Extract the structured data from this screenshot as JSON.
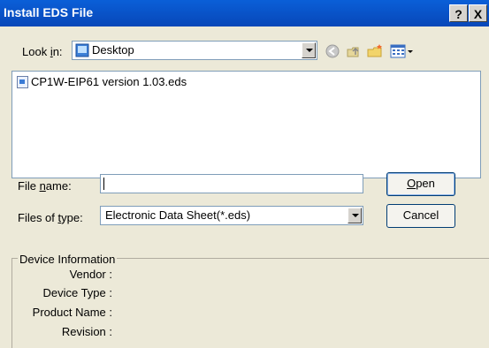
{
  "window": {
    "title": "Install EDS File",
    "help_label": "?",
    "close_label": "X"
  },
  "lookin": {
    "label_pre": "Look ",
    "label_u": "i",
    "label_post": "n:",
    "value": "Desktop"
  },
  "toolbar": {
    "icons": [
      "back-icon",
      "up-folder-icon",
      "new-folder-icon",
      "view-menu-icon"
    ]
  },
  "files": [
    {
      "name": "CP1W-EIP61 version 1.03.eds",
      "icon": "eds-file-icon"
    }
  ],
  "filename": {
    "label_pre": "File ",
    "label_u": "n",
    "label_post": "ame:",
    "value": ""
  },
  "filetype": {
    "label_pre": "Files of ",
    "label_u": "t",
    "label_post": "ype:",
    "value": "Electronic Data Sheet(*.eds)"
  },
  "buttons": {
    "open_u": "O",
    "open_rest": "pen",
    "cancel": "Cancel"
  },
  "device": {
    "legend": "Device Information",
    "vendor": "Vendor :",
    "device_type": "Device Type :",
    "product_name": "Product Name :",
    "revision": "Revision :"
  },
  "colors": {
    "title_bar": "#0a5fd8",
    "dialog_bg": "#ece9d8",
    "border": "#7f9db9"
  }
}
